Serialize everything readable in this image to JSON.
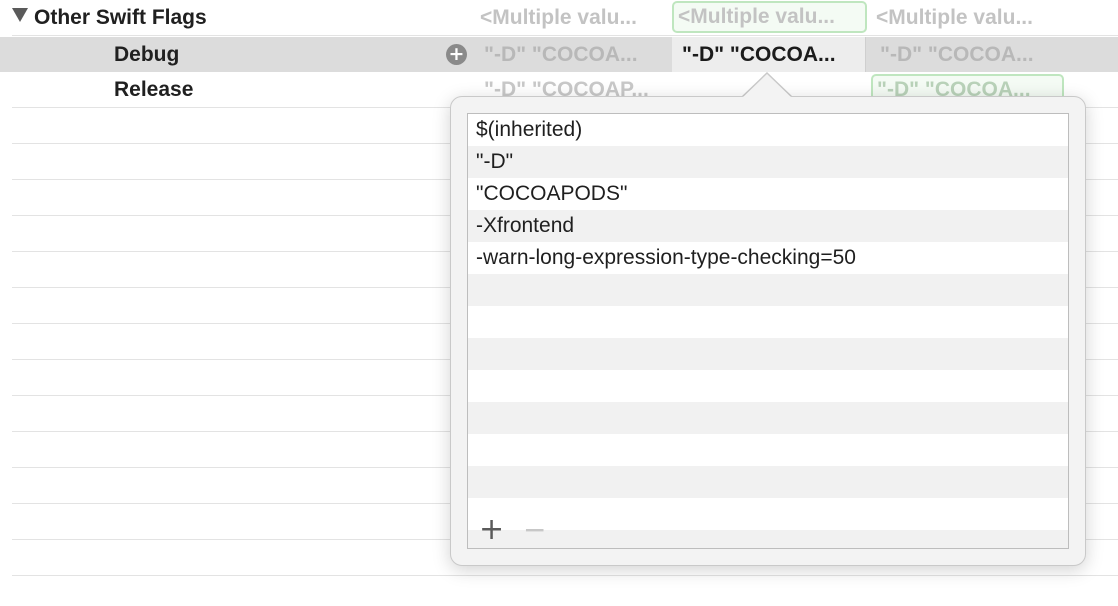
{
  "setting": {
    "title": "Other Swift Flags",
    "values": [
      "<Multiple valu...",
      "<Multiple valu...",
      "<Multiple valu..."
    ]
  },
  "rows": [
    {
      "label": "Debug",
      "values": [
        "\"-D\" \"COCOA...",
        "\"-D\" \"COCOA...",
        "\"-D\" \"COCOA..."
      ]
    },
    {
      "label": "Release",
      "values": [
        "\"-D\" \"COCOAP...",
        "",
        "\"-D\" \"COCOA..."
      ]
    }
  ],
  "popover": {
    "items": [
      "$(inherited)",
      "\"-D\"",
      "\"COCOAPODS\"",
      "-Xfrontend",
      "-warn-long-expression-type-checking=50"
    ],
    "add_label": "+",
    "remove_label": "−"
  },
  "icons": {
    "disclosure": "disclosure-triangle-down-icon",
    "add_row": "plus-circle-icon"
  },
  "colors": {
    "selected_row": "#dcdcdc",
    "highlight_border": "#bfe6bf"
  }
}
